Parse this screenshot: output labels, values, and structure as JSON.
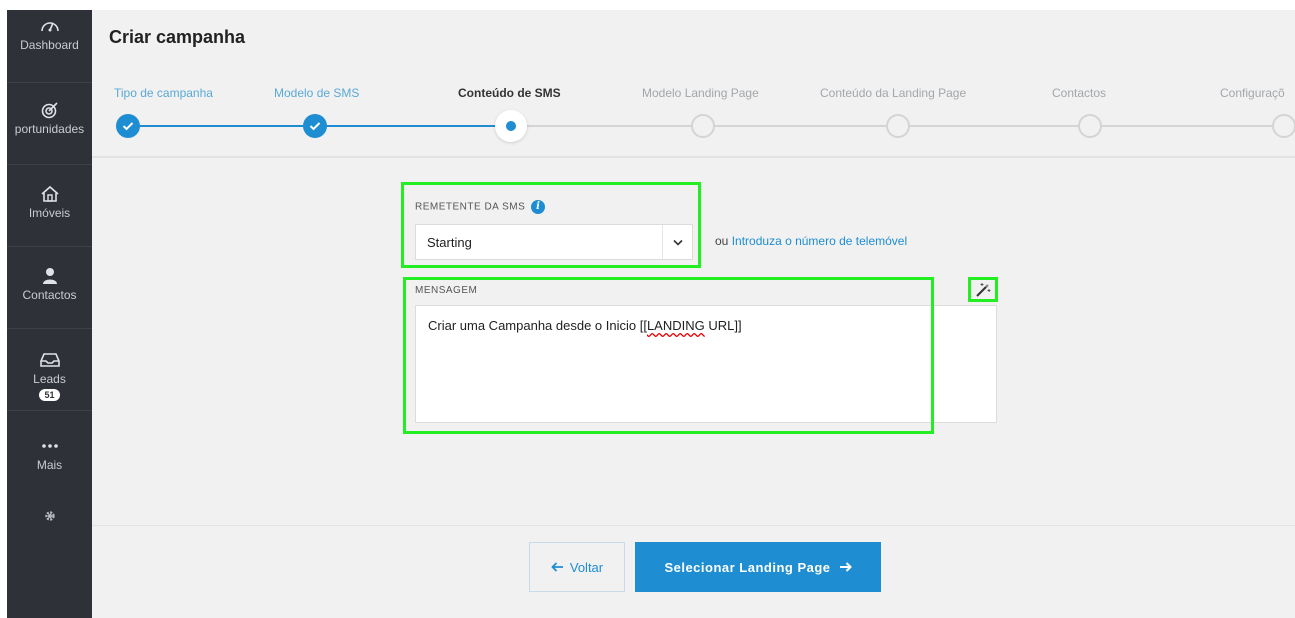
{
  "sidebar": {
    "items": [
      {
        "label": "Dashboard",
        "icon": "gauge-icon"
      },
      {
        "label": "portunidades",
        "icon": "target-icon"
      },
      {
        "label": "Imóveis",
        "icon": "home-icon"
      },
      {
        "label": "Contactos",
        "icon": "user-icon"
      },
      {
        "label": "Leads",
        "icon": "inbox-icon",
        "badge": "51"
      },
      {
        "label": "Mais",
        "icon": "more-icon"
      },
      {
        "label": "",
        "icon": "gear-icon"
      }
    ]
  },
  "header": {
    "title": "Criar campanha",
    "steps": [
      {
        "label": "Tipo de campanha",
        "state": "done"
      },
      {
        "label": "Modelo de SMS",
        "state": "done"
      },
      {
        "label": "Conteúdo de SMS",
        "state": "active"
      },
      {
        "label": "Modelo Landing Page",
        "state": "todo"
      },
      {
        "label": "Conteúdo da Landing Page",
        "state": "todo"
      },
      {
        "label": "Contactos",
        "state": "todo"
      },
      {
        "label": "Configuraçõ",
        "state": "todo"
      }
    ]
  },
  "form": {
    "sender_label": "REMETENTE DA SMS",
    "sender_info_icon": "i",
    "sender_value": "Starting",
    "or_prefix": "ou",
    "or_link": "Introduza o número de telemóvel",
    "message_label": "MENSAGEM",
    "message_before": "Criar uma Campanha desde o Inicio [[",
    "message_underlined": "LANDING",
    "message_after": " URL]]"
  },
  "footer": {
    "back_label": "Voltar",
    "next_label": "Selecionar Landing Page"
  },
  "colors": {
    "accent": "#1e8dd2",
    "sidebar_bg": "#2e3238",
    "page_bg": "#f1f1f1",
    "highlight": "#22ee22"
  }
}
